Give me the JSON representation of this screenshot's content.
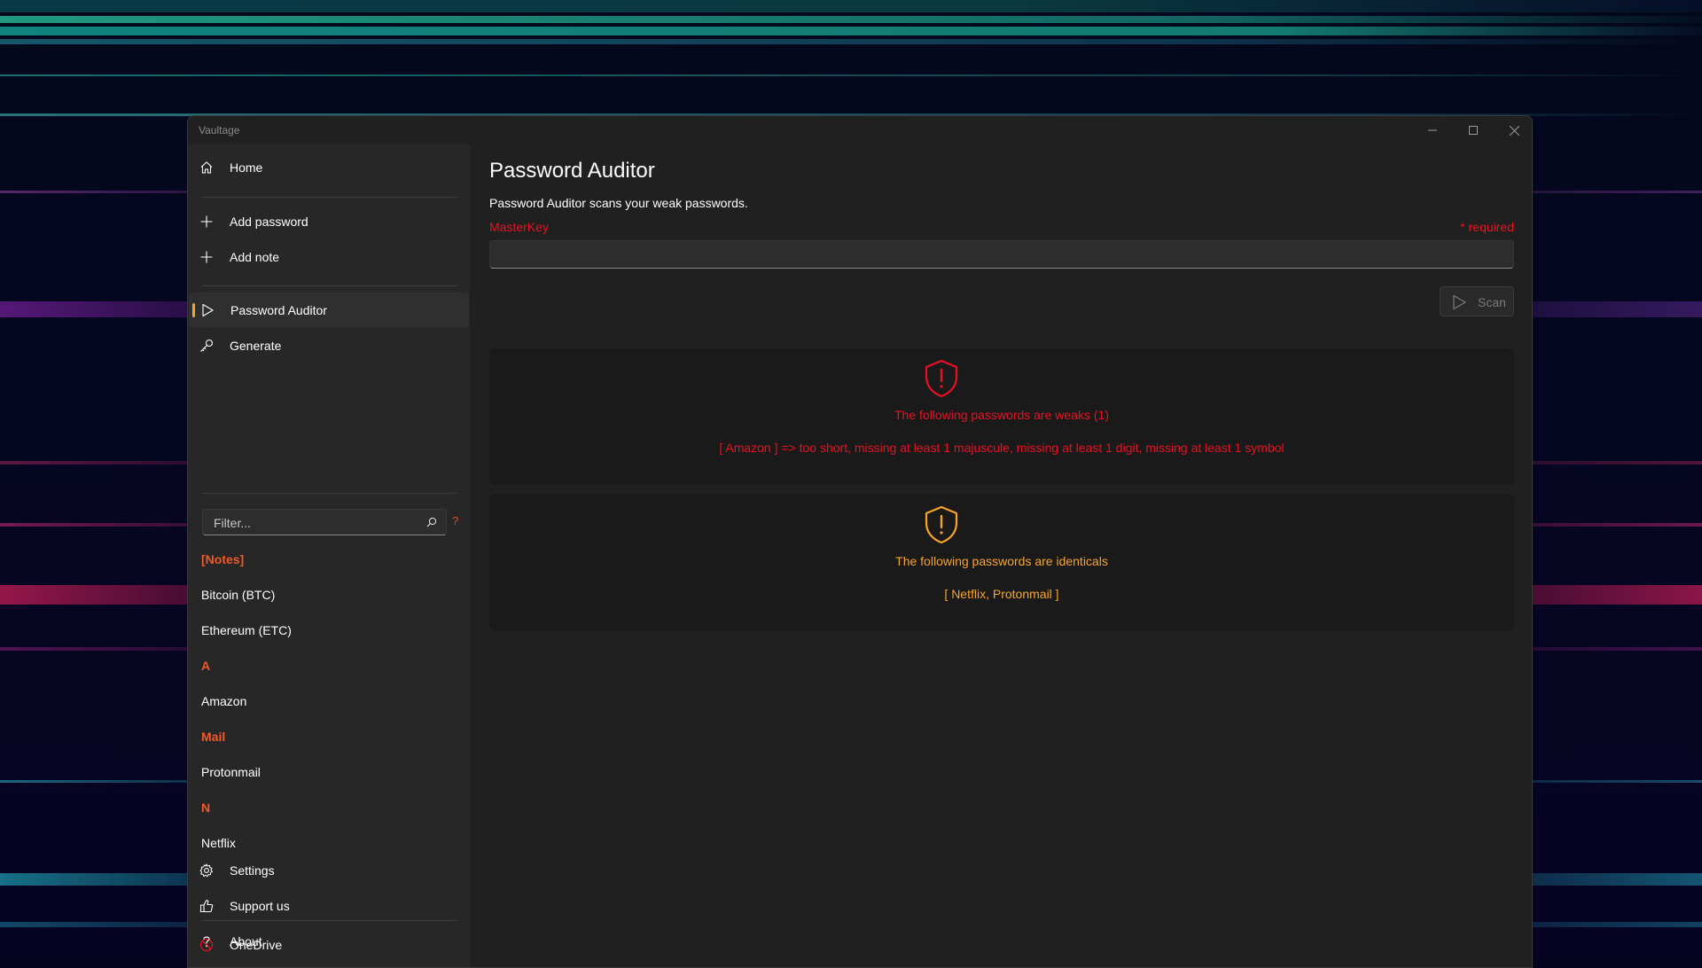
{
  "window": {
    "title": "Vaultage"
  },
  "sidebar": {
    "nav_top": [
      {
        "label": "Home",
        "icon": "home-icon"
      }
    ],
    "nav_add": [
      {
        "label": "Add password",
        "icon": "plus-icon"
      },
      {
        "label": "Add note",
        "icon": "plus-icon"
      }
    ],
    "nav_tools": [
      {
        "label": "Password Auditor",
        "icon": "play-icon",
        "selected": true
      },
      {
        "label": "Generate",
        "icon": "key-icon"
      }
    ],
    "filter": {
      "placeholder": "Filter...",
      "help": "?"
    },
    "groups": [
      {
        "header": "[Notes]",
        "items": [
          "Bitcoin (BTC)",
          "Ethereum (ETC)"
        ]
      },
      {
        "header": "A",
        "items": [
          "Amazon"
        ]
      },
      {
        "header": "Mail",
        "items": [
          "Protonmail"
        ]
      },
      {
        "header": "N",
        "items": [
          "Netflix"
        ]
      }
    ],
    "nav_bottom": [
      {
        "label": "OneDrive",
        "icon": "onedrive-disabled-icon"
      },
      {
        "label": "Settings",
        "icon": "gear-icon"
      },
      {
        "label": "Support us",
        "icon": "thumbs-up-icon"
      },
      {
        "label": "About",
        "icon": "question-icon"
      }
    ]
  },
  "main": {
    "title": "Password Auditor",
    "description": "Password Auditor scans your weak passwords.",
    "masterkey_label": "MasterKey",
    "required_label": "* required",
    "masterkey_value": "",
    "scan_label": "Scan",
    "results": [
      {
        "severity": "error",
        "color": "#e81123",
        "heading": "The following passwords are weaks (1)",
        "detail": "[ Amazon ] => too short, missing at least 1 majuscule, missing at least 1 digit, missing at least 1 symbol"
      },
      {
        "severity": "warning",
        "color": "#f7a42c",
        "heading": "The following passwords are identicals",
        "detail": "[ Netflix, Protonmail ]"
      }
    ]
  },
  "colors": {
    "accent": "#f7a42c",
    "group_header": "#f05a28",
    "error": "#e81123",
    "warning": "#f7a42c"
  }
}
